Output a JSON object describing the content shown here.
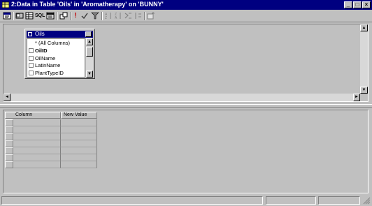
{
  "window": {
    "title": "2:Data in Table 'Oils' in 'Aromatherapy' on 'BUNNY'",
    "controls": {
      "minimize": "_",
      "maximize": "□",
      "close": "×"
    }
  },
  "toolbar": {
    "buttons": [
      {
        "icon": "properties-icon"
      },
      {
        "icon": "diagram-pane-icon"
      },
      {
        "icon": "grid-pane-icon"
      },
      {
        "icon": "sql-pane-label",
        "label": "SQL"
      },
      {
        "icon": "results-pane-icon"
      },
      {
        "icon": "change-type-icon"
      },
      {
        "icon": "run-icon",
        "label": "!"
      },
      {
        "icon": "verify-sql-icon"
      },
      {
        "icon": "remove-filter-icon"
      },
      {
        "icon": "sort-ascending-icon"
      },
      {
        "icon": "sort-descending-icon"
      },
      {
        "icon": "use-group-by-icon"
      },
      {
        "icon": "add-table-icon"
      }
    ]
  },
  "diagram": {
    "table": {
      "name": "Oils",
      "columns": [
        "* (All Columns)",
        "OilID",
        "OilName",
        "LatinName",
        "PlantTypeID"
      ]
    }
  },
  "grid": {
    "headers": [
      "Column",
      "New Value"
    ],
    "row_count": 7
  }
}
